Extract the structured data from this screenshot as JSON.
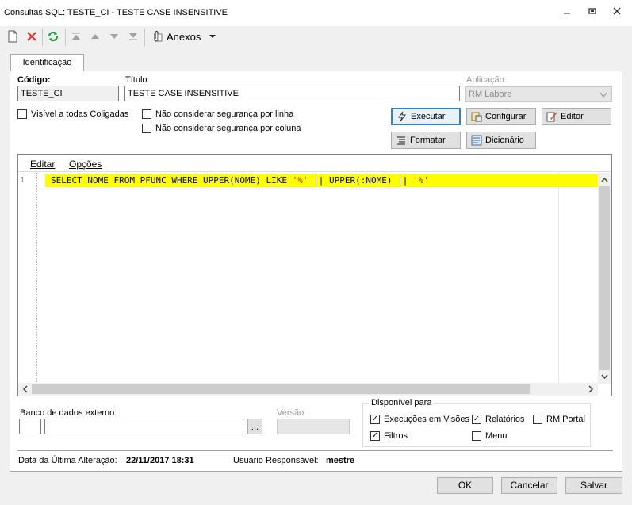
{
  "window": {
    "title": "Consultas SQL: TESTE_CI - TESTE CASE INSENSITIVE",
    "minimize": "▭",
    "restore": "▣",
    "close": "✕"
  },
  "toolbar": {
    "anexos_label": "Anexos"
  },
  "tabs": [
    {
      "label": "Identificação"
    }
  ],
  "form": {
    "codigo_label": "Código:",
    "codigo_value": "TESTE_CI",
    "titulo_label": "Título:",
    "titulo_value": "TESTE CASE INSENSITIVE",
    "aplicacao_label": "Aplicação:",
    "aplicacao_value": "RM Labore",
    "visivel_label": "Visível a todas Coligadas",
    "seg_linha_label": "Não considerar segurança por linha",
    "seg_coluna_label": "Não considerar segurança por coluna"
  },
  "actions": {
    "executar": "Executar",
    "configurar": "Configurar",
    "editor": "Editor",
    "formatar": "Formatar",
    "dicionario": "Dicionário"
  },
  "editor": {
    "menu_editar": "Editar",
    "menu_opcoes": "Opções",
    "line_number": "1",
    "sql_parts": {
      "p1": "SELECT NOME FROM PFUNC WHERE UPPER(NOME) LIKE ",
      "s1": "'%'",
      "p2": " || UPPER(:NOME) || ",
      "s2": "'%'"
    }
  },
  "db": {
    "banco_label": "Banco de dados externo:",
    "browse_label": "...",
    "versao_label": "Versão:"
  },
  "disponivel": {
    "title": "Disponível para",
    "execucoes": "Execuções em Visões",
    "relatorios": "Relatórios",
    "rm_portal": "RM Portal",
    "filtros": "Filtros",
    "menu": "Menu",
    "check_mark": "✓"
  },
  "footer": {
    "data_label": "Data da Última Alteração:",
    "data_value": "22/11/2017 18:31",
    "usuario_label": "Usuário Responsável:",
    "usuario_value": "mestre"
  },
  "buttons": {
    "ok": "OK",
    "cancelar": "Cancelar",
    "salvar": "Salvar"
  },
  "colors": {
    "highlight": "#ffff00",
    "accent": "#3c7fb1"
  }
}
